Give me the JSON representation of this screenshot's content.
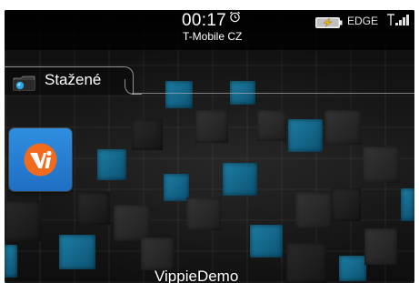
{
  "status_bar": {
    "time": "00:17",
    "carrier": "T-Mobile CZ",
    "network_type": "EDGE",
    "alarm_icon": "alarm-clock-icon",
    "battery_icon": "battery-charging-icon",
    "signal_icon": "signal-strength-icon"
  },
  "folder": {
    "label": "Stažené",
    "icon": "folder-icon"
  },
  "apps": [
    {
      "label": "VippieDemo",
      "icon": "vippie-logo-icon"
    }
  ],
  "colors": {
    "accent_blue": "#1d7fa6",
    "app_icon_blue": "#2f8ee0",
    "logo_orange": "#f26a1b"
  }
}
